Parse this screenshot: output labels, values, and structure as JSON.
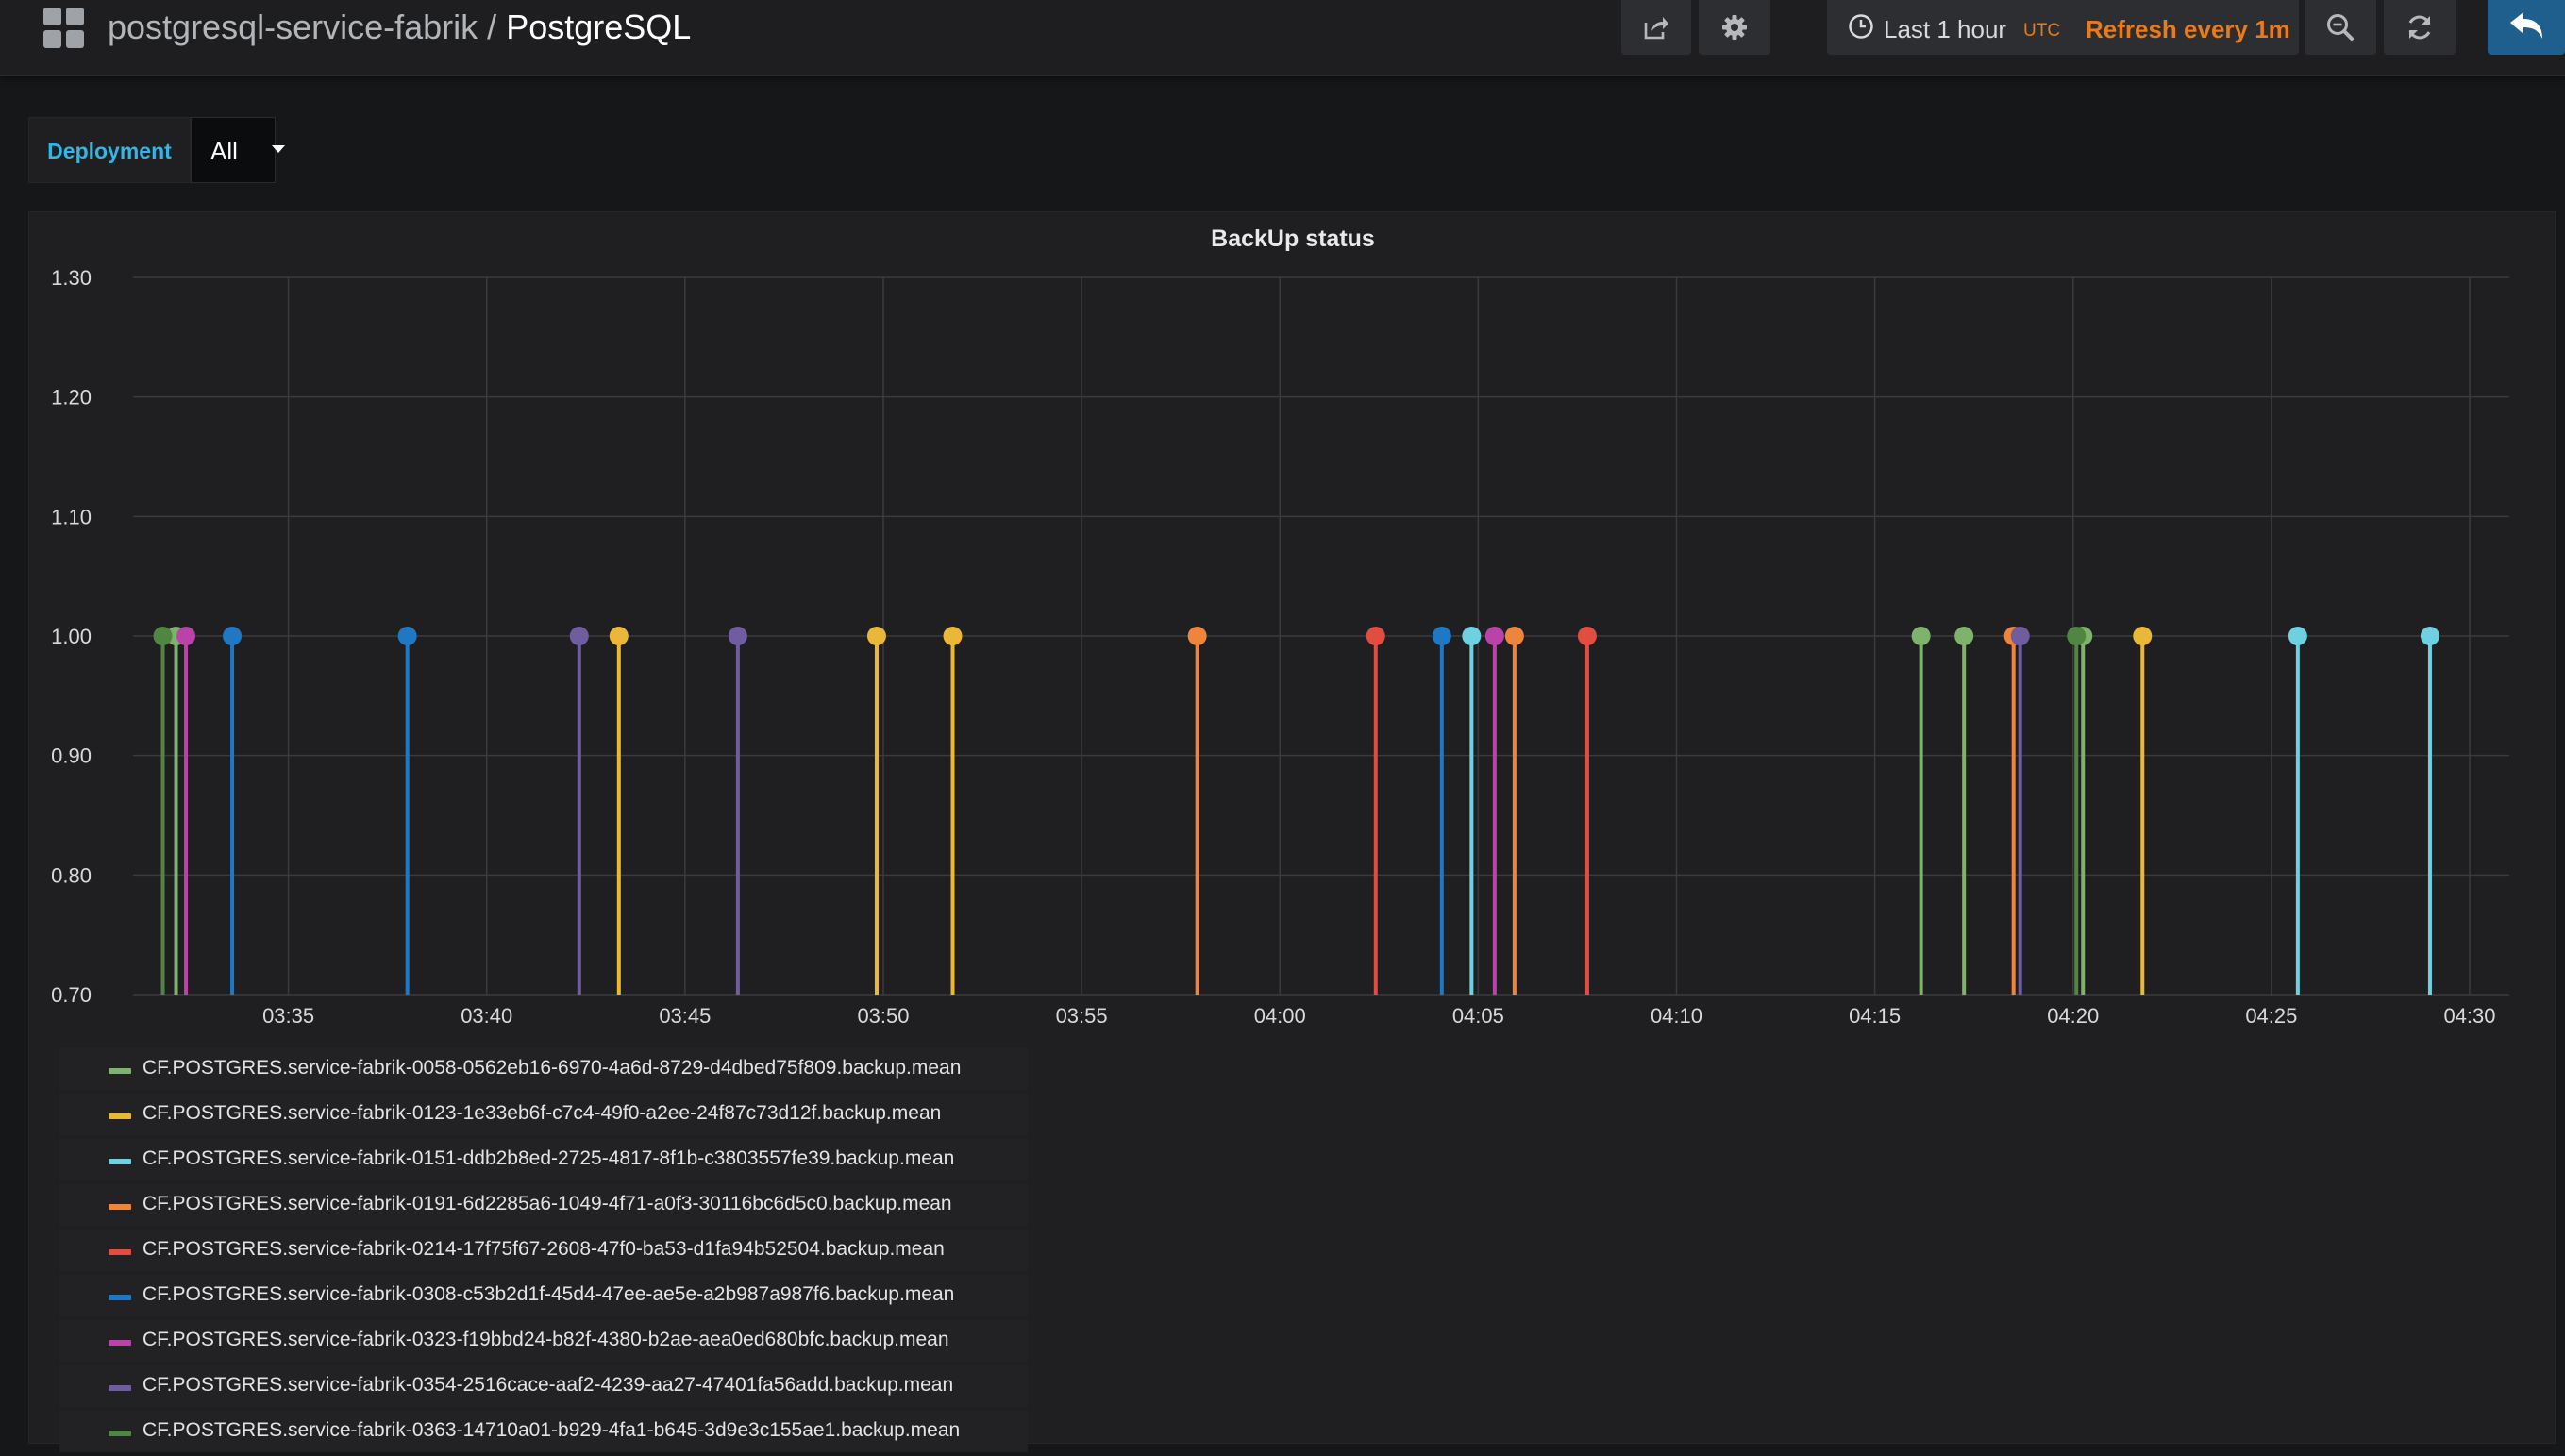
{
  "header": {
    "folder": "postgresql-service-fabrik",
    "separator": "/",
    "title": "PostgreSQL",
    "time_range": "Last 1 hour",
    "timezone": "UTC",
    "refresh": "Refresh every 1m"
  },
  "variables": {
    "label": "Deployment",
    "value": "All"
  },
  "icons": [
    "grid-icon",
    "share-icon",
    "gear-icon",
    "clock-icon",
    "zoom-out-icon",
    "refresh-icon",
    "back-arrow-icon",
    "caret-down-icon"
  ],
  "colors": {
    "accent": "#eb7b18",
    "variable_label": "#33b5e5",
    "back_button": "#1f5f8e"
  },
  "chart_data": {
    "type": "scatter",
    "title": "BackUp status",
    "ylim": [
      0.7,
      1.3
    ],
    "yticks": [
      "0.70",
      "0.80",
      "0.90",
      "1.00",
      "1.10",
      "1.20",
      "1.30"
    ],
    "xticks": [
      "03:35",
      "03:40",
      "03:45",
      "03:50",
      "03:55",
      "04:00",
      "04:05",
      "04:10",
      "04:15",
      "04:20",
      "04:25",
      "04:30"
    ],
    "xlim": [
      "03:31:05",
      "04:31:00"
    ],
    "grid": true,
    "legend_position": "bottom",
    "series": [
      {
        "name": "CF.POSTGRES.service-fabrik-0058-0562eb16-6970-4a6d-8729-d4dbed75f809.backup.mean",
        "color": "#7eb26d",
        "points": [
          [
            "03:32:10",
            1.0
          ],
          [
            "04:16:10",
            1.0
          ],
          [
            "04:17:15",
            1.0
          ],
          [
            "04:20:15",
            1.0
          ]
        ]
      },
      {
        "name": "CF.POSTGRES.service-fabrik-0123-1e33eb6f-c7c4-49f0-a2ee-24f87c73d12f.backup.mean",
        "color": "#eab839",
        "points": [
          [
            "03:43:20",
            1.0
          ],
          [
            "03:49:50",
            1.0
          ],
          [
            "03:51:45",
            1.0
          ],
          [
            "04:21:45",
            1.0
          ]
        ]
      },
      {
        "name": "CF.POSTGRES.service-fabrik-0151-ddb2b8ed-2725-4817-8f1b-c3803557fe39.backup.mean",
        "color": "#6ed0e0",
        "points": [
          [
            "04:04:50",
            1.0
          ],
          [
            "04:25:40",
            1.0
          ],
          [
            "04:29:00",
            1.0
          ]
        ]
      },
      {
        "name": "CF.POSTGRES.service-fabrik-0191-6d2285a6-1049-4f71-a0f3-30116bc6d5c0.backup.mean",
        "color": "#ef843c",
        "points": [
          [
            "03:57:55",
            1.0
          ],
          [
            "04:05:55",
            1.0
          ],
          [
            "04:18:30",
            1.0
          ]
        ]
      },
      {
        "name": "CF.POSTGRES.service-fabrik-0214-17f75f67-2608-47f0-ba53-d1fa94b52504.backup.mean",
        "color": "#e24d42",
        "points": [
          [
            "04:02:25",
            1.0
          ],
          [
            "04:07:45",
            1.0
          ]
        ]
      },
      {
        "name": "CF.POSTGRES.service-fabrik-0308-c53b2d1f-45d4-47ee-ae5e-a2b987a987f6.backup.mean",
        "color": "#1f78c1",
        "points": [
          [
            "03:33:35",
            1.0
          ],
          [
            "03:38:00",
            1.0
          ],
          [
            "04:04:05",
            1.0
          ]
        ]
      },
      {
        "name": "CF.POSTGRES.service-fabrik-0323-f19bbd24-b82f-4380-b2ae-aea0ed680bfc.backup.mean",
        "color": "#ba43a9",
        "points": [
          [
            "03:32:25",
            1.0
          ],
          [
            "04:05:25",
            1.0
          ]
        ]
      },
      {
        "name": "CF.POSTGRES.service-fabrik-0354-2516cace-aaf2-4239-aa27-47401fa56add.backup.mean",
        "color": "#705da0",
        "points": [
          [
            "03:42:20",
            1.0
          ],
          [
            "03:46:20",
            1.0
          ],
          [
            "04:18:40",
            1.0
          ]
        ]
      },
      {
        "name": "CF.POSTGRES.service-fabrik-0363-14710a01-b929-4fa1-b645-3d9e3c155ae1.backup.mean",
        "color": "#508642",
        "points": [
          [
            "03:31:50",
            1.0
          ],
          [
            "04:20:05",
            1.0
          ]
        ]
      }
    ]
  }
}
